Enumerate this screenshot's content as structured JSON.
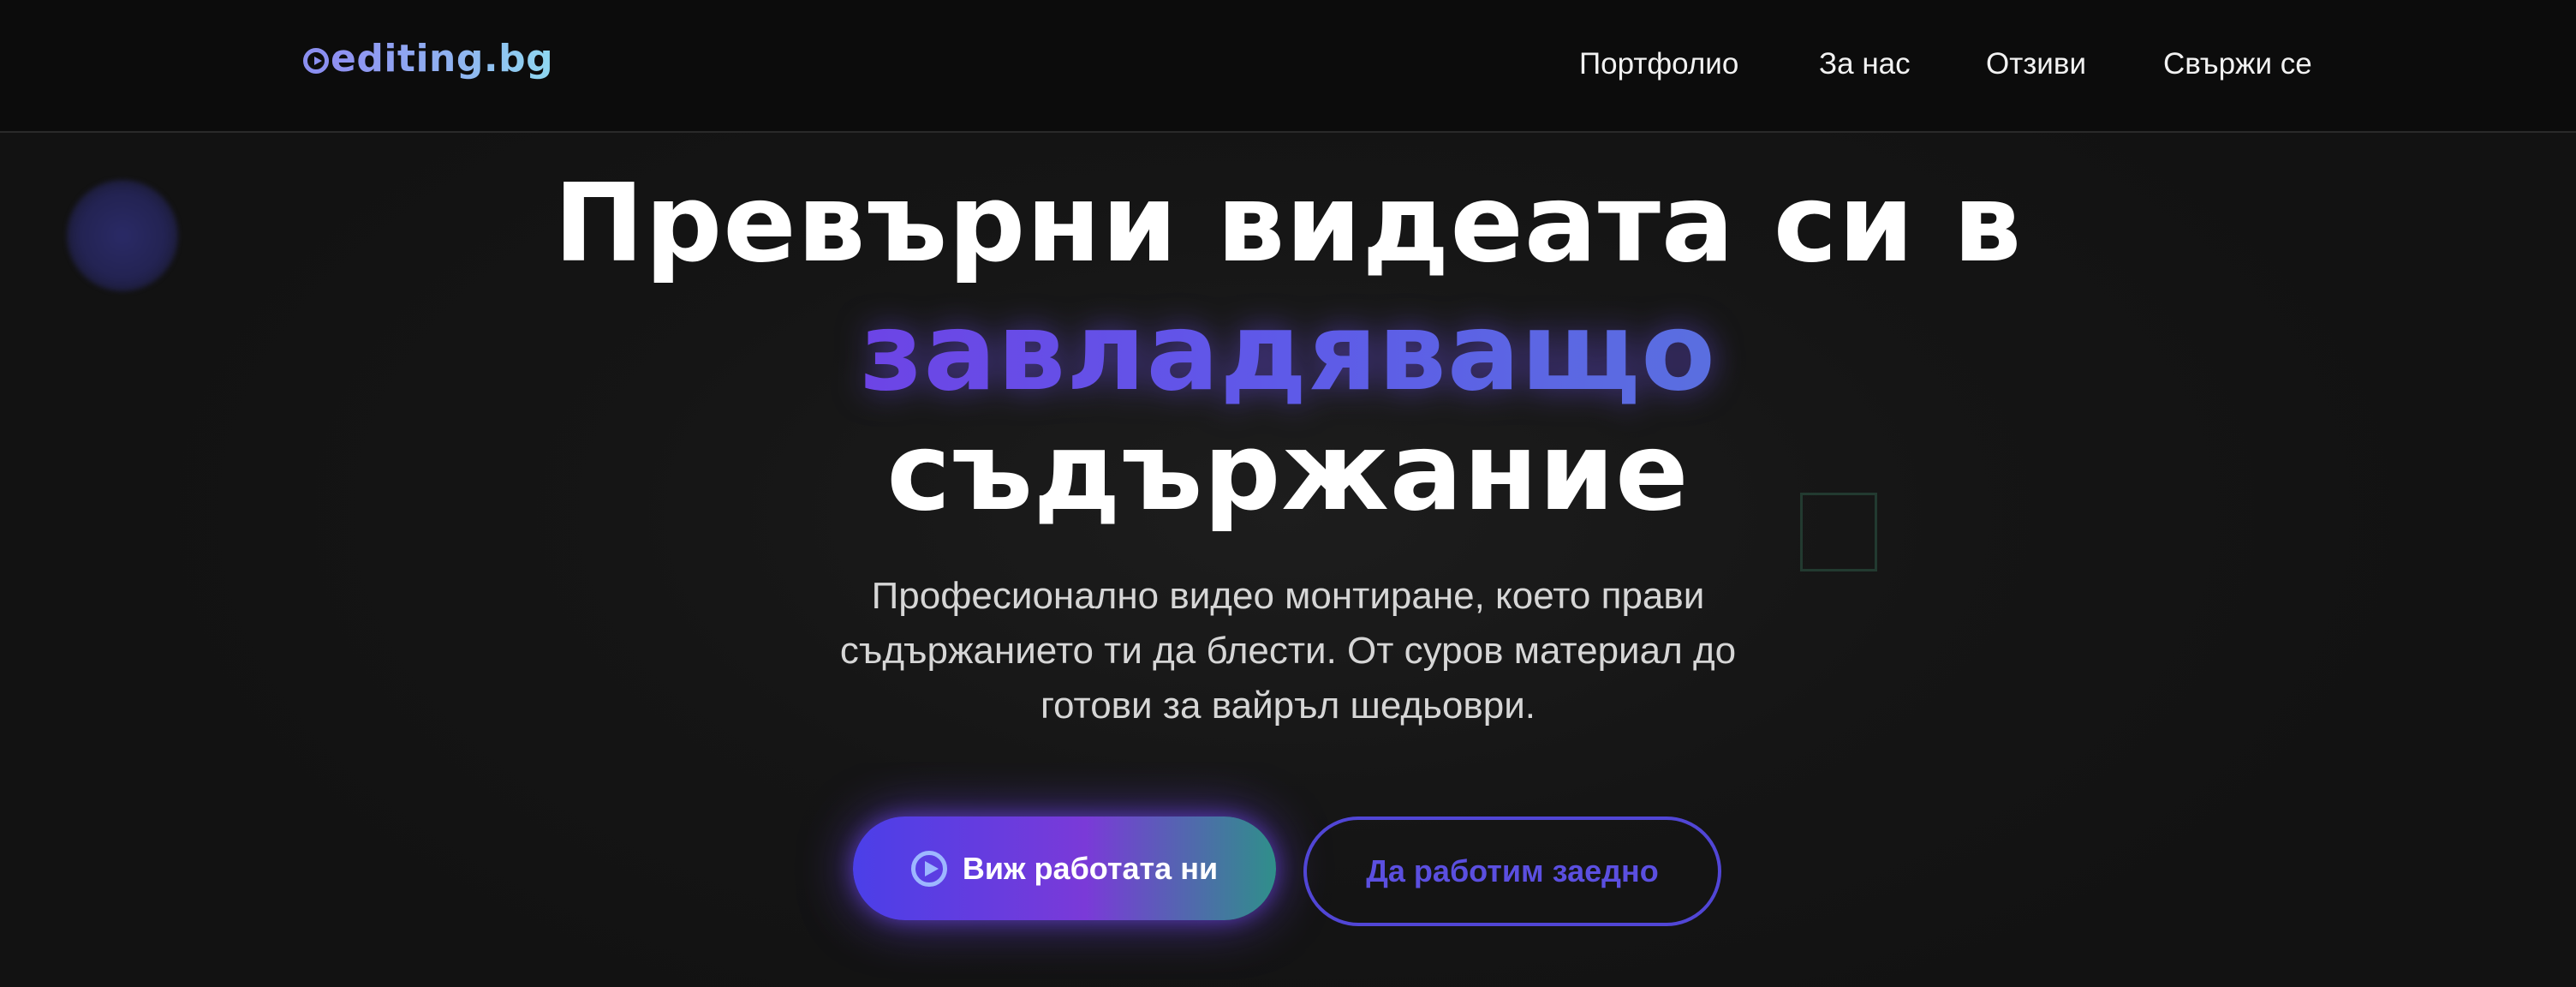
{
  "header": {
    "logo_text": "editing.bg",
    "nav": [
      {
        "label": "Портфолио"
      },
      {
        "label": "За нас"
      },
      {
        "label": "Отзиви"
      },
      {
        "label": "Свържи се"
      }
    ]
  },
  "hero": {
    "title_line1": "Превърни видеата си в",
    "title_accent": "завладяващо",
    "title_line3": "съдържание",
    "subtitle_line1": "Професионално видео монтиране, което прави",
    "subtitle_line2": "съдържанието ти да блести. От суров материал до",
    "subtitle_line3": "готови за вайръл шедьоври."
  },
  "buttons": {
    "primary_label": "Виж работата ни",
    "secondary_label": "Да работим заедно"
  },
  "colors": {
    "background": "#141414",
    "header_bg": "#0c0c0c",
    "accent": "#5e5ae8",
    "button_gradient_start": "#4b3fe8",
    "button_gradient_mid": "#7a3ad8",
    "button_gradient_end": "#2f8f8a",
    "secondary_border": "#5146d6"
  },
  "icons": {
    "logo": "play-circle-icon",
    "primary_button": "play-circle-icon"
  }
}
